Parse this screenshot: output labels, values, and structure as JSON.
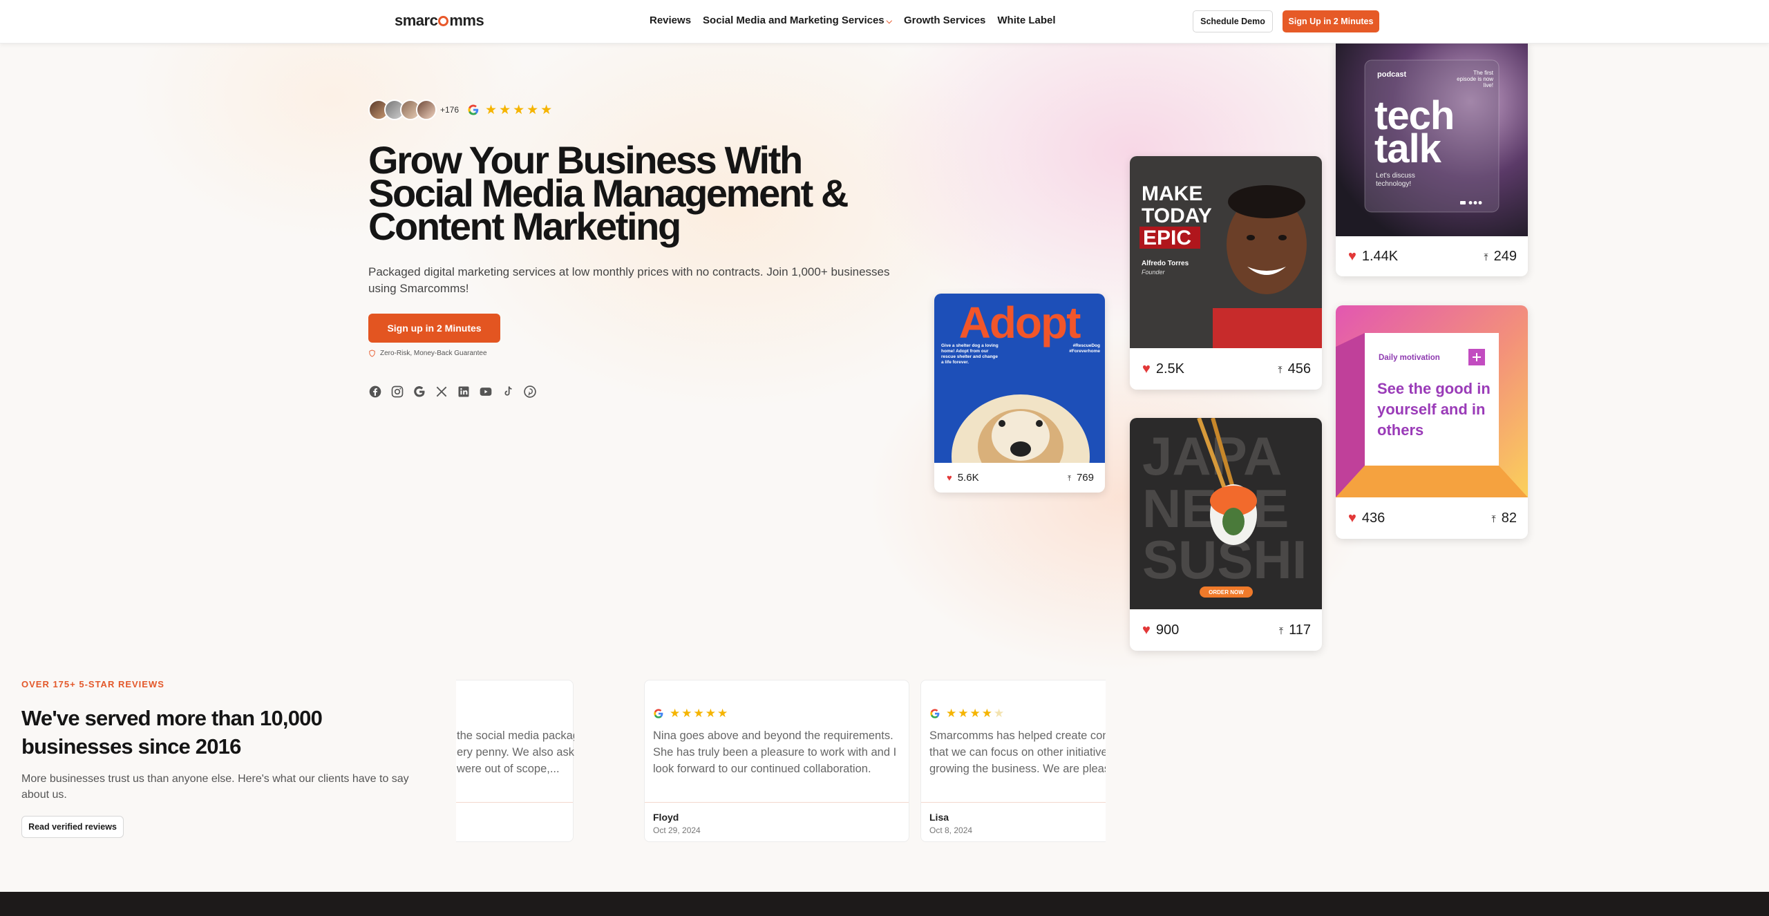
{
  "nav": {
    "logo_pre": "smarc",
    "logo_post": "mms",
    "links": [
      "Reviews",
      "Social Media and Marketing Services",
      "Growth Services",
      "White Label"
    ],
    "schedule_demo": "Schedule Demo",
    "sign_up": "Sign Up in 2 Minutes"
  },
  "hero": {
    "avatar_count": "+176",
    "stars": "★★★★★",
    "headline": "Grow Your Business With Social Media Management & Content Marketing",
    "subtext": "Packaged digital marketing services at low monthly prices with no contracts. Join 1,000+ businesses using Smarcomms!",
    "cta": "Sign up in 2 Minutes",
    "guarantee": "Zero-Risk, Money-Back Guarantee",
    "socials": [
      "facebook-icon",
      "instagram-icon",
      "google-icon",
      "x-icon",
      "linkedin-icon",
      "youtube-icon",
      "tiktok-icon",
      "pinterest-icon"
    ]
  },
  "cards": {
    "adopt": {
      "title": "Adopt",
      "body": "Give a shelter dog a loving home! Adopt from our rescue shelter and change a life forever.",
      "tags": "#RescueDog #Foreverhome",
      "likes": "5.6K",
      "shares": "769"
    },
    "epic": {
      "line1": "MAKE",
      "line2": "TODAY",
      "line3": "EPIC",
      "name": "Alfredo Torres",
      "role": "Founder",
      "likes": "2.5K",
      "shares": "456"
    },
    "sushi": {
      "line1": "JAPA",
      "line2": "NESE",
      "line3": "SUSHI",
      "button": "ORDER NOW",
      "likes": "900",
      "shares": "117"
    },
    "podcast": {
      "tag": "podcast",
      "note": "The first episode is now live!",
      "title1": "tech",
      "title2": "talk",
      "sub": "Let's discuss technology!",
      "likes": "1.44K",
      "shares": "249"
    },
    "motivation": {
      "tag": "Daily motivation",
      "quote": "See the good in yourself and in others",
      "likes": "436",
      "shares": "82"
    }
  },
  "reviews": {
    "label": "OVER 175+ 5-STAR REVIEWS",
    "title": "We've served more than 10,000 businesses since 2016",
    "subtitle": "More businesses trust us than anyone else. Here's what our clients have to say about us.",
    "button": "Read verified reviews",
    "items": [
      {
        "text": "the social media package ery penny. We also asked were out of scope,...",
        "name": "",
        "date": "",
        "stars": "★★★★★"
      },
      {
        "text": "Nina goes above and beyond the requirements. She has truly been a pleasure to work with and I look forward to our continued collaboration.",
        "name": "Floyd",
        "date": "Oct 29, 2024",
        "stars": "★★★★★"
      },
      {
        "text": "Smarcomms has helped create con that we can focus on other initiative growing the business. We are pleas",
        "name": "Lisa",
        "date": "Oct 8, 2024",
        "stars": "★★★★",
        "star_empty": "★"
      }
    ]
  },
  "colors": {
    "accent": "#e65a27",
    "star": "#f5b400",
    "heart": "#e23838",
    "footer": "#1d1a1a"
  }
}
